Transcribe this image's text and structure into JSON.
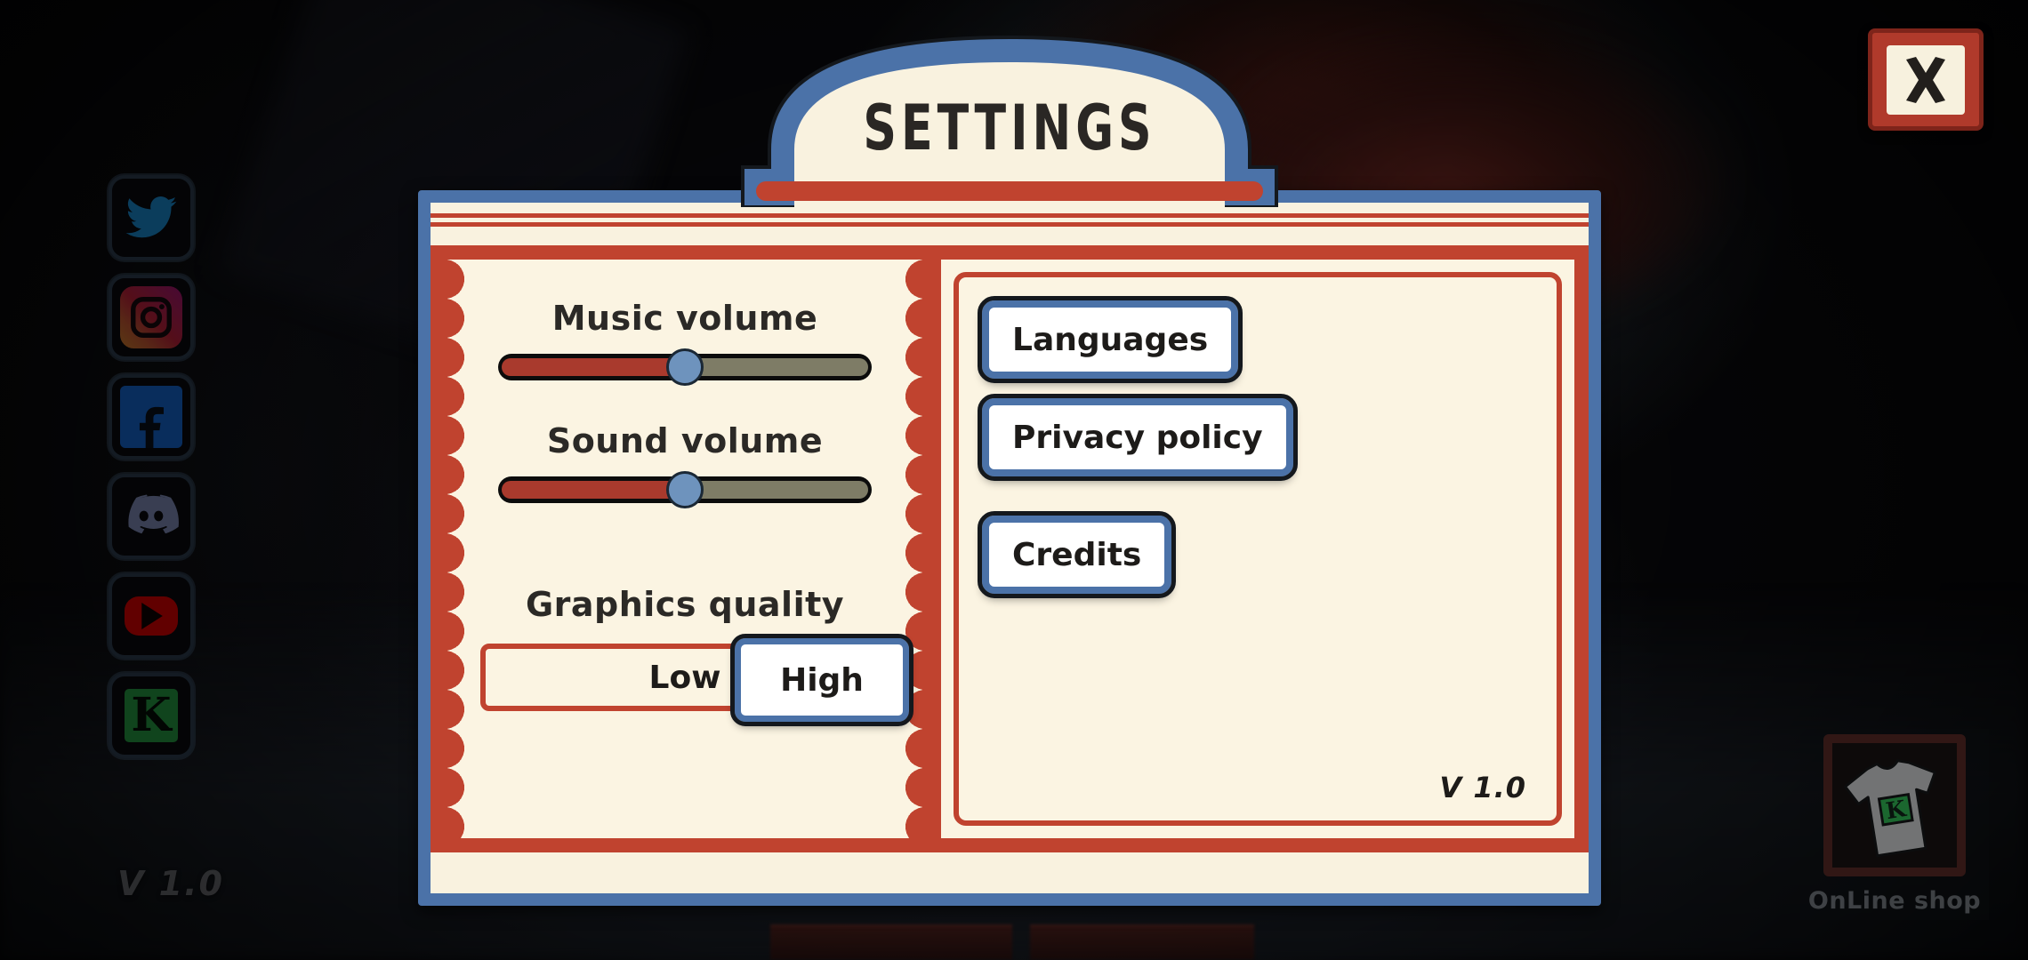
{
  "background": {
    "version_text": "V 1.0"
  },
  "social": {
    "items": [
      {
        "name": "twitter",
        "icon": "twitter-icon",
        "label": "Twitter"
      },
      {
        "name": "instagram",
        "icon": "instagram-icon",
        "label": "Instagram"
      },
      {
        "name": "facebook",
        "icon": "facebook-icon",
        "label": "Facebook",
        "glyph": "f"
      },
      {
        "name": "discord",
        "icon": "discord-icon",
        "label": "Discord"
      },
      {
        "name": "youtube",
        "icon": "youtube-icon",
        "label": "YouTube"
      },
      {
        "name": "kickstarter",
        "icon": "kickstarter-k-icon",
        "label": "K",
        "glyph": "K"
      }
    ]
  },
  "shop": {
    "label": "OnLine shop",
    "icon": "tshirt-icon",
    "shirt_logo": "K"
  },
  "close_button": {
    "icon": "close-x-icon",
    "label": "X"
  },
  "dialog": {
    "title": "SETTINGS",
    "left_panel": {
      "music": {
        "label": "Music volume",
        "value": 50,
        "min": 0,
        "max": 100
      },
      "sound": {
        "label": "Sound volume",
        "value": 50,
        "min": 0,
        "max": 100
      },
      "graphics": {
        "label": "Graphics quality",
        "options": [
          "Low",
          "High"
        ],
        "selected": "High"
      }
    },
    "right_panel": {
      "buttons": [
        {
          "label": "Languages",
          "name": "languages-button"
        },
        {
          "label": "Privacy policy",
          "name": "privacy-policy-button"
        },
        {
          "label": "Credits",
          "name": "credits-button"
        }
      ],
      "version": "V 1.0"
    }
  },
  "colors": {
    "cream": "#fbf4e2",
    "red": "#c0432f",
    "blue": "#4b72a8",
    "slider_fill": "#a93a2d",
    "slider_rest": "#7e7c66",
    "knob": "#6e93bd",
    "ink": "#1d1b19"
  }
}
